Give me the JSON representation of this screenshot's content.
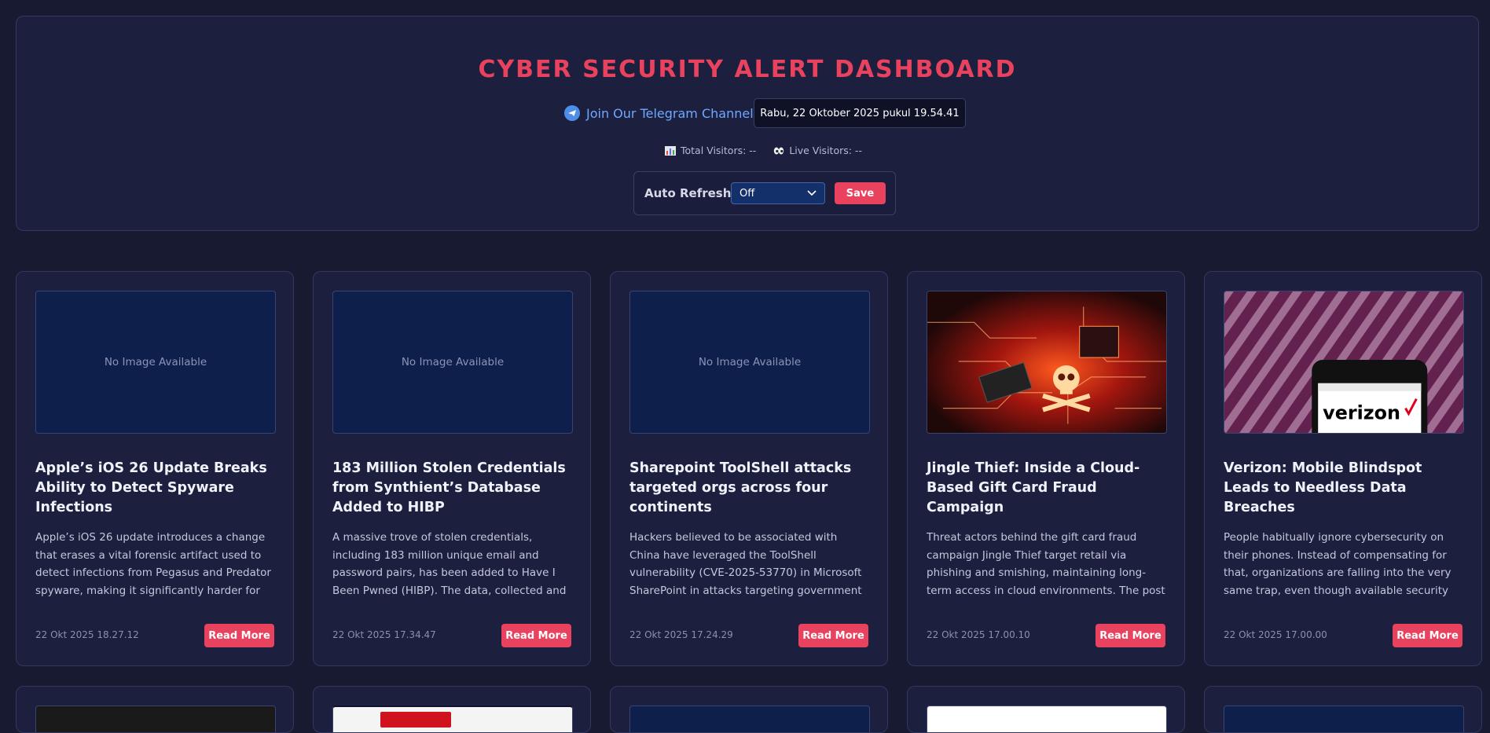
{
  "header": {
    "title": "CYBER SECURITY ALERT DASHBOARD",
    "telegram_label": "Join Our Telegram Channel",
    "datetime": "Rabu, 22 Oktober 2025 pukul 19.54.41",
    "total_visitors": "Total Visitors: --",
    "live_visitors": "Live Visitors: --",
    "auto_refresh_label": "Auto Refresh:",
    "auto_refresh_value": "Off",
    "save_label": "Save"
  },
  "colors": {
    "accent": "#e8425f",
    "background": "#171a30",
    "card": "#1c1f3e",
    "link": "#6ea8ff"
  },
  "cards": [
    {
      "image": "No Image Available",
      "title": "Apple’s iOS 26 Update Breaks Ability to Detect Spyware Infections",
      "desc": "Apple’s iOS 26 update introduces a change that erases a vital forensic artifact used to detect infections from Pegasus and Predator spyware, making it significantly harder for researchers an...",
      "date": "22 Okt 2025 18.27.12",
      "read_more": "Read More"
    },
    {
      "image": "No Image Available",
      "title": "183 Million Stolen Credentials from Synthient’s Database Added to HIBP",
      "desc": "A massive trove of stolen credentials, including 183 million unique email and password pairs, has been added to Have I Been Pwned (HIBP). The data, collected and curated by a US-based...",
      "date": "22 Okt 2025 17.34.47",
      "read_more": "Read More"
    },
    {
      "image": "No Image Available",
      "title": "Sharepoint ToolShell attacks targeted orgs across four continents",
      "desc": "Hackers believed to be associated with China have leveraged the ToolShell vulnerability (CVE-2025-53770) in Microsoft SharePoint in attacks targeting government agencies, universities,...",
      "date": "22 Okt 2025 17.24.29",
      "read_more": "Read More"
    },
    {
      "image": "",
      "title": "Jingle Thief: Inside a Cloud-Based Gift Card Fraud Campaign",
      "desc": "Threat actors behind the gift card fraud campaign Jingle Thief target retail via phishing and smishing, maintaining long-term access in cloud environments. The post Jingle Thief: Insid...",
      "date": "22 Okt 2025 17.00.10",
      "read_more": "Read More"
    },
    {
      "image": "verizon",
      "title": "Verizon: Mobile Blindspot Leads to Needless Data Breaches",
      "desc": "People habitually ignore cybersecurity on their phones. Instead of compensating for that, organizations are falling into the very same trap, even though available security options could c...",
      "date": "22 Okt 2025 17.00.00",
      "read_more": "Read More"
    }
  ]
}
